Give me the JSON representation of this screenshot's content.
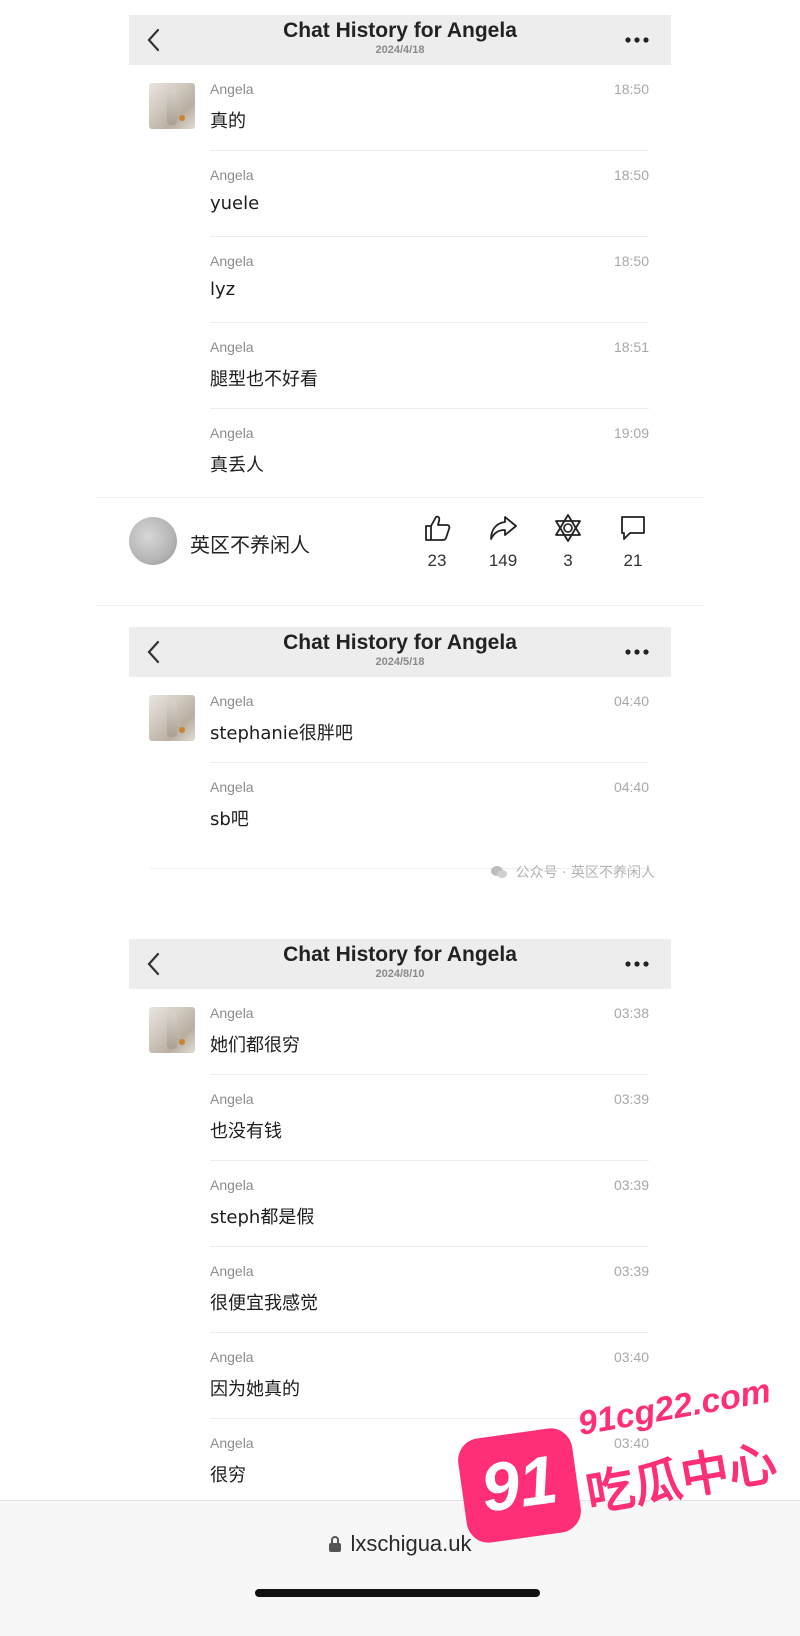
{
  "chats": [
    {
      "title": "Chat History for Angela",
      "date": "2024/4/18",
      "messages": [
        {
          "name": "Angela",
          "time": "18:50",
          "text": "真的"
        },
        {
          "name": "Angela",
          "time": "18:50",
          "text": "yuele"
        },
        {
          "name": "Angela",
          "time": "18:50",
          "text": "lyz"
        },
        {
          "name": "Angela",
          "time": "18:51",
          "text": "腿型也不好看"
        },
        {
          "name": "Angela",
          "time": "19:09",
          "text": "真丢人"
        }
      ]
    },
    {
      "title": "Chat History for Angela",
      "date": "2024/5/18",
      "messages": [
        {
          "name": "Angela",
          "time": "04:40",
          "text": "stephanie很胖吧"
        },
        {
          "name": "Angela",
          "time": "04:40",
          "text": "sb吧"
        }
      ]
    },
    {
      "title": "Chat History for Angela",
      "date": "2024/8/10",
      "messages": [
        {
          "name": "Angela",
          "time": "03:38",
          "text": "她们都很穷"
        },
        {
          "name": "Angela",
          "time": "03:39",
          "text": "也没有钱"
        },
        {
          "name": "Angela",
          "time": "03:39",
          "text": "steph都是假"
        },
        {
          "name": "Angela",
          "time": "03:39",
          "text": "很便宜我感觉"
        },
        {
          "name": "Angela",
          "time": "03:40",
          "text": "因为她真的"
        },
        {
          "name": "Angela",
          "time": "03:40",
          "text": "很穷"
        }
      ]
    }
  ],
  "social": {
    "username": "英区不养闲人",
    "likes": "23",
    "shares": "149",
    "favorites": "3",
    "comments": "21"
  },
  "watermark": "公众号 · 英区不养闲人",
  "browser": {
    "url": "lxschigua.uk"
  },
  "logo": {
    "badge": "91",
    "site": "91cg22.com",
    "name": "吃瓜中心"
  },
  "colors": {
    "header_bg": "#ededed",
    "logo_pink": "#ff2e79"
  },
  "icons": [
    "back-chevron-icon",
    "more-dots-icon",
    "thumbs-up-icon",
    "share-arrow-icon",
    "star-of-david-icon",
    "comment-bubble-icon",
    "lock-icon",
    "wechat-icon"
  ]
}
